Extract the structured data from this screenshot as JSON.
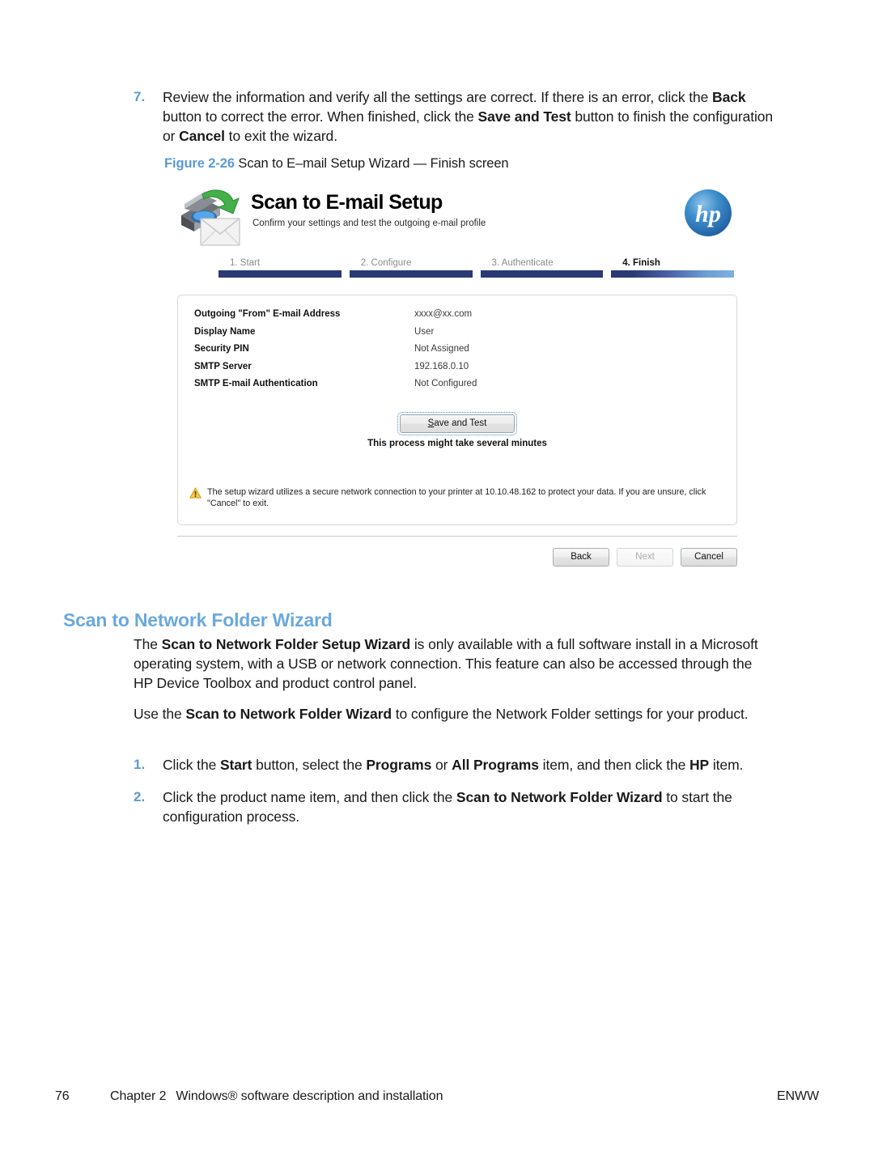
{
  "steps_list": [
    {
      "number": "7.",
      "html": "Review the information and verify all the settings are correct. If there is an error, click the <b>Back</b> button to correct the error. When finished, click the <b>Save and Test</b> button to finish the configuration or <b>Cancel</b> to exit the wizard."
    }
  ],
  "figure": {
    "caption_label": "Figure 2-26",
    "caption_text": "Scan to E–mail Setup Wizard — Finish screen",
    "wizard": {
      "title": "Scan to E-mail Setup",
      "subtitle": "Confirm your settings and test the outgoing e-mail profile",
      "brand": "hp",
      "steps": [
        {
          "label": "1. Start",
          "active": false
        },
        {
          "label": "2. Configure",
          "active": false
        },
        {
          "label": "3. Authenticate",
          "active": false
        },
        {
          "label": "4. Finish",
          "active": true
        }
      ],
      "settings": [
        {
          "label": "Outgoing \"From\" E-mail Address",
          "value": "xxxx@xx.com"
        },
        {
          "label": "Display Name",
          "value": "User"
        },
        {
          "label": "Security PIN",
          "value": "Not Assigned"
        },
        {
          "label": "SMTP Server",
          "value": "192.168.0.10"
        },
        {
          "label": "SMTP E-mail Authentication",
          "value": "Not Configured"
        }
      ],
      "save_button": "Save and Test",
      "save_button_accel": "S",
      "save_button_rest": "ave and Test",
      "save_note": "This process might take several minutes",
      "warning": "The setup wizard utilizes a secure network connection to your printer at 10.10.48.162 to protect your data. If you are unsure, click \"Cancel\" to exit.",
      "nav_buttons": [
        {
          "label": "Back",
          "disabled": false
        },
        {
          "label": "Next",
          "disabled": true
        },
        {
          "label": "Cancel",
          "disabled": false
        }
      ],
      "accent_navy": "#2b3a75",
      "accent_light_blue": "#7fb0e0"
    }
  },
  "section": {
    "heading": "Scan to Network Folder Wizard",
    "paragraphs": [
      "The <b>Scan to Network Folder Setup Wizard</b> is only available with a full software install in a Microsoft operating system, with a USB or network connection. This feature can also be accessed through the HP Device Toolbox and product control panel.",
      "Use the <b>Scan to Network Folder Wizard</b> to configure the Network Folder settings for your product."
    ],
    "numbered": [
      {
        "number": "1.",
        "html": "Click the <b>Start</b> button, select the <b>Programs</b> or <b>All Programs</b> item, and then click the <b>HP</b> item."
      },
      {
        "number": "2.",
        "html": "Click the product name item, and then click the <b>Scan to Network Folder Wizard</b> to start the configuration process."
      }
    ]
  },
  "footer": {
    "page_number": "76",
    "chapter": "Chapter 2",
    "description": "Windows® software description and installation",
    "edition": "ENWW"
  },
  "colors": {
    "heading_blue": "#6aa9dd",
    "number_blue": "#5b9bd5",
    "warning_amber": "#f2b233"
  }
}
